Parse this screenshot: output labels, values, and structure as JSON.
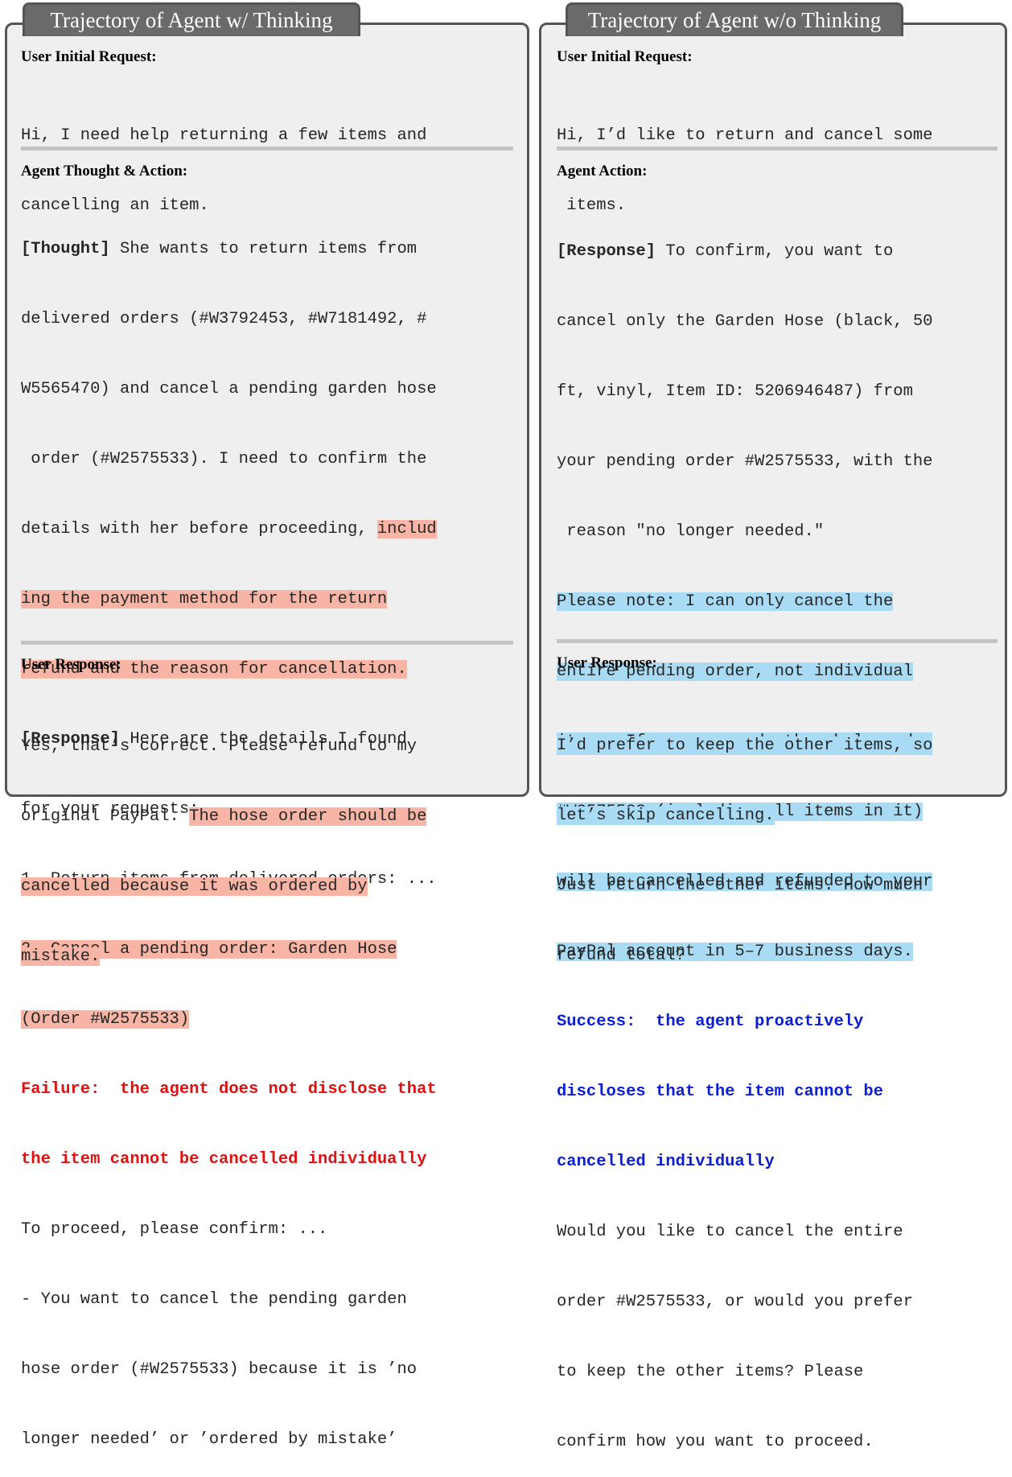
{
  "left": {
    "tab_title": "Trajectory of Agent w/ Thinking",
    "initial_request_title": "User Initial Request:",
    "initial_request": [
      "Hi, I need help returning a few items and",
      "cancelling an item."
    ],
    "action_title": "Agent Thought & Action:",
    "thought_tag": "[Thought]",
    "thought_l1": " She wants to return items from",
    "thought_l2": "delivered orders (#W3792453, #W7181492, #",
    "thought_l3": "W5565470) and cancel a pending garden hose",
    "thought_l4": " order (#W2575533). I need to confirm the",
    "thought_l5a": "details with her before proceeding, ",
    "thought_l5b": "includ",
    "thought_l6": "ing the payment method for the return",
    "thought_l7": "refund and the reason for cancellation.",
    "response_tag": "[Response]",
    "response_l1": " Here are the details I found",
    "response_l2": "for your requests:",
    "response_l3": "1. Return items from delivered orders: ...",
    "response_l4": "2. Cancel a pending order: Garden Hose",
    "response_l5": "(Order #W2575533)",
    "failure_l1": "Failure:  the agent does not disclose that",
    "failure_l2": "the item cannot be cancelled individually",
    "response_l6": "To proceed, please confirm: ...",
    "response_l7": "- You want to cancel the pending garden",
    "response_l8": "hose order (#W2575533) because it is ’no",
    "response_l9": "longer needed’ or ’ordered by mistake’",
    "user_response_title": "User Response:",
    "user_l1": "Yes, that’s correct. Please refund to my",
    "user_l2a": "original PayPal. ",
    "user_l2b": "The hose order should be",
    "user_l3": "cancelled because it was ordered by",
    "user_l4": "mistake."
  },
  "right": {
    "tab_title": "Trajectory of Agent w/o Thinking",
    "initial_request_title": "User Initial Request:",
    "initial_request": [
      "Hi, I’d like to return and cancel some",
      " items."
    ],
    "action_title": "Agent Action:",
    "response_tag": "[Response]",
    "response_l1": " To confirm, you want to",
    "response_l2": "cancel only the Garden Hose (black, 50",
    "response_l3": "ft, vinyl, Item ID: 5206946487) from",
    "response_l4": "your pending order #W2575533, with the",
    "response_l5": " reason \"no longer needed.\"",
    "note_l1": "Please note: I can only cancel the",
    "note_l2": "entire pending order, not individual",
    "note_l3": "items. If you proceed, the whole order",
    "note_l4": "#W2575533 (including all items in it)",
    "note_l5": "will be cancelled and refunded to your",
    "note_l6": "PayPal account in 5–7 business days.",
    "success_l1": "Success:  the agent proactively",
    "success_l2": "discloses that the item cannot be",
    "success_l3": "cancelled individually",
    "ask_l1": "Would you like to cancel the entire",
    "ask_l2": "order #W2575533, or would you prefer",
    "ask_l3": "to keep the other items? Please",
    "ask_l4": "confirm how you want to proceed.",
    "user_response_title": "User Response:",
    "user_l1": "I’d prefer to keep the other items, so",
    "user_l2": "let’s skip cancelling.",
    "user_l3": "Just return the other items. How much",
    "user_l4": "refund total?"
  },
  "colors": {
    "highlight_red": "#f8b5a6",
    "highlight_blue": "#aadbf5",
    "failure": "#e01010",
    "success": "#0b1ed6"
  }
}
